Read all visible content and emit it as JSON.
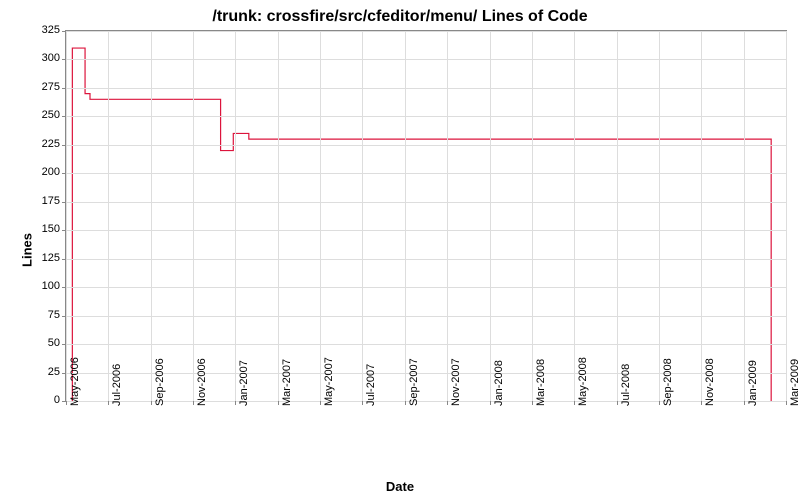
{
  "chart_data": {
    "type": "line",
    "title": "/trunk: crossfire/src/cfeditor/menu/ Lines of Code",
    "xlabel": "Date",
    "ylabel": "Lines",
    "ylim": [
      0,
      325
    ],
    "x_ticks": [
      "May-2006",
      "Jul-2006",
      "Sep-2006",
      "Nov-2006",
      "Jan-2007",
      "Mar-2007",
      "May-2007",
      "Jul-2007",
      "Sep-2007",
      "Nov-2007",
      "Jan-2008",
      "Mar-2008",
      "May-2008",
      "Jul-2008",
      "Sep-2008",
      "Nov-2008",
      "Jan-2009",
      "Mar-2009"
    ],
    "y_ticks": [
      0,
      25,
      50,
      75,
      100,
      125,
      150,
      175,
      200,
      225,
      250,
      275,
      300,
      325
    ],
    "series": [
      {
        "name": "Lines of Code",
        "color": "#dc143c",
        "points": [
          {
            "x": "2006-05-10",
            "y": 0
          },
          {
            "x": "2006-05-10",
            "y": 310
          },
          {
            "x": "2006-05-28",
            "y": 310
          },
          {
            "x": "2006-05-28",
            "y": 270
          },
          {
            "x": "2006-06-05",
            "y": 270
          },
          {
            "x": "2006-06-05",
            "y": 265
          },
          {
            "x": "2006-12-10",
            "y": 265
          },
          {
            "x": "2006-12-10",
            "y": 220
          },
          {
            "x": "2006-12-28",
            "y": 220
          },
          {
            "x": "2006-12-28",
            "y": 235
          },
          {
            "x": "2007-01-20",
            "y": 235
          },
          {
            "x": "2007-01-20",
            "y": 230
          },
          {
            "x": "2009-02-10",
            "y": 230
          },
          {
            "x": "2009-02-10",
            "y": 0
          }
        ]
      }
    ]
  }
}
